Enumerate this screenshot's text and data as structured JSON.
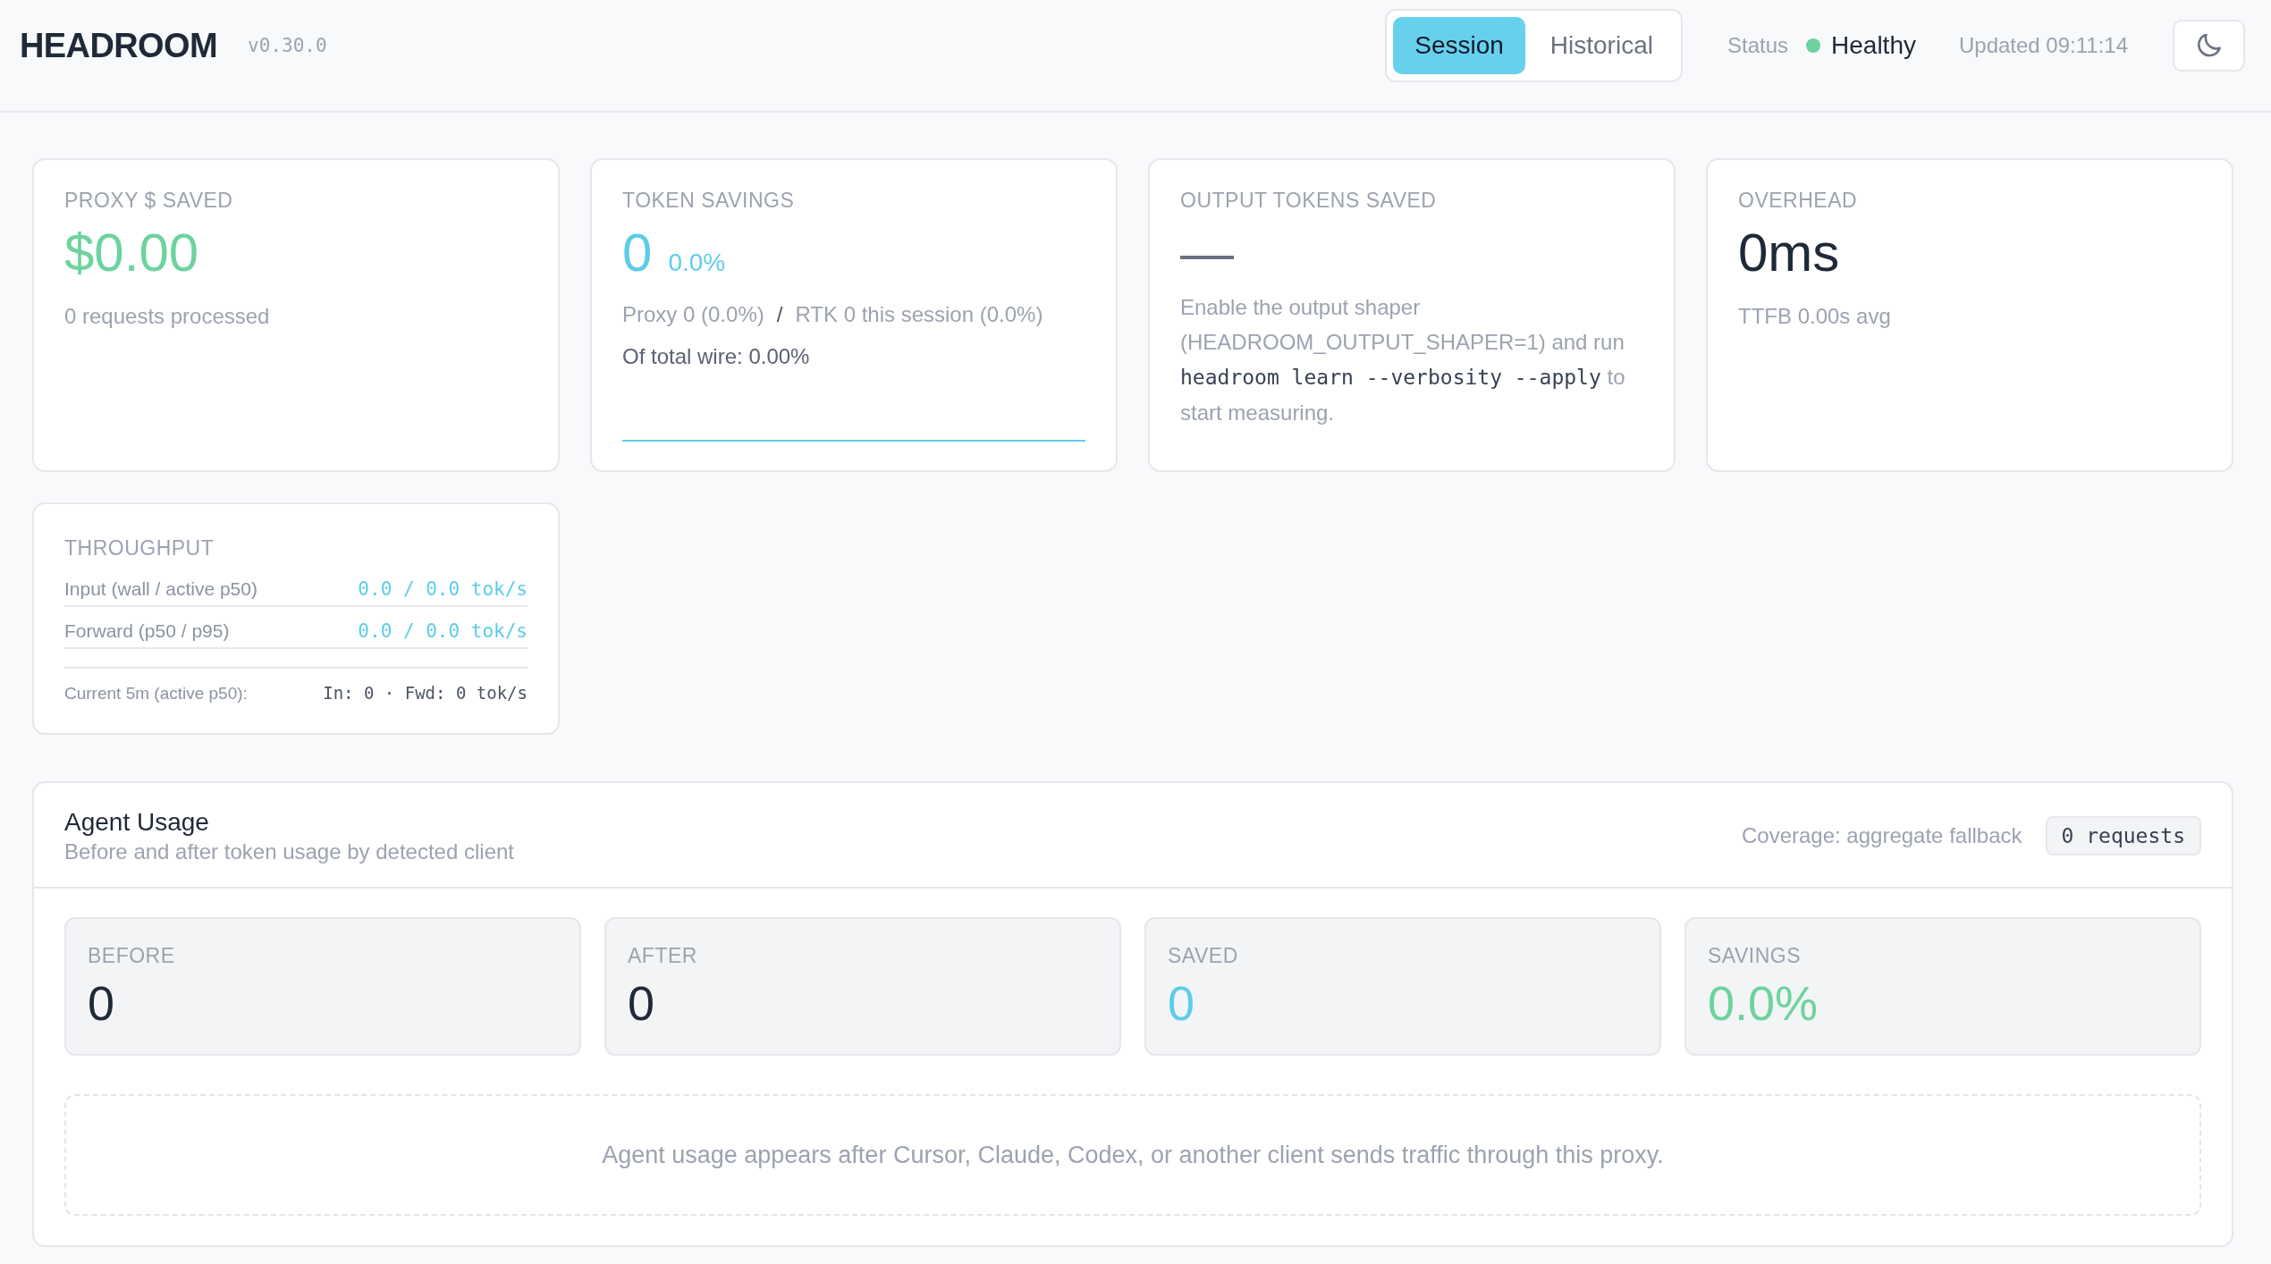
{
  "header": {
    "logo": "HEADROOM",
    "version": "v0.30.0",
    "tabs": [
      {
        "label": "Session",
        "selected": true
      },
      {
        "label": "Historical",
        "selected": false
      }
    ],
    "status": {
      "label": "Status",
      "value": "Healthy",
      "color": "#6cd39e"
    },
    "updated": "Updated 09:11:14"
  },
  "cards": [
    {
      "kind": "stat",
      "label": "PROXY $ SAVED",
      "value": "$0.00",
      "color": "#6cd39e",
      "note": "0 requests processed"
    },
    {
      "kind": "tokens",
      "label": "TOKEN SAVINGS",
      "value": "0",
      "percent": "0.0%",
      "color": "#5ccde9",
      "breakdown": {
        "proxy": "Proxy 0 (0.0%)",
        "separator": "/",
        "rtk": "RTK 0 this session (0.0%)"
      },
      "wire": "Of total wire: 0.00%"
    },
    {
      "kind": "hint",
      "label": "OUTPUT TOKENS SAVED",
      "value": "—",
      "color": "#6b7280",
      "hint": {
        "lead": "Enable the output shaper (HEADROOM_OUTPUT_SHAPER=1) and run",
        "command": "headroom learn --verbosity --apply",
        "tail": "to start measuring."
      }
    },
    {
      "kind": "stat",
      "label": "OVERHEAD",
      "value": "0ms",
      "color": "#1f2937",
      "note": "TTFB 0.00s avg"
    }
  ],
  "throughput": {
    "label": "THROUGHPUT",
    "rows": [
      {
        "label": "Input (wall / active p50)",
        "value": "0.0 / 0.0 tok/s"
      },
      {
        "label": "Forward (p50 / p95)",
        "value": "0.0 / 0.0 tok/s"
      }
    ],
    "current": {
      "label": "Current 5m (active p50):",
      "value": "In: 0 · Fwd: 0 tok/s"
    }
  },
  "agent_usage": {
    "title": "Agent Usage",
    "subtitle": "Before and after token usage by detected client",
    "coverage": "Coverage: aggregate fallback",
    "requests": "0 requests",
    "stats": [
      {
        "label": "BEFORE",
        "value": "0",
        "color": "#1f2937"
      },
      {
        "label": "AFTER",
        "value": "0",
        "color": "#1f2937"
      },
      {
        "label": "SAVED",
        "value": "0",
        "color": "#5ccde9"
      },
      {
        "label": "SAVINGS",
        "value": "0.0%",
        "color": "#6cd39e"
      }
    ],
    "empty_message": "Agent usage appears after Cursor, Claude, Codex, or another client sends traffic through this proxy."
  }
}
